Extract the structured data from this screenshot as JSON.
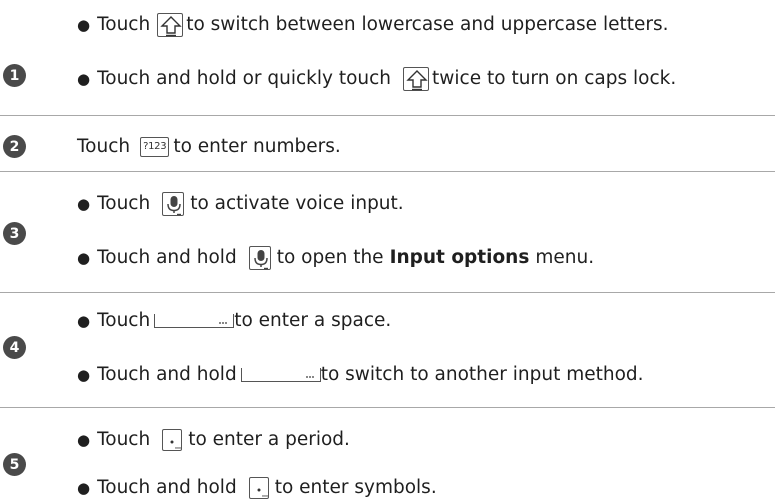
{
  "rows": [
    {
      "number": "1",
      "lines": [
        {
          "prefix": "Touch",
          "icon": "shift-key-icon",
          "suffix": "to switch between lowercase and uppercase letters."
        },
        {
          "prefix": "Touch and hold or quickly touch",
          "icon": "shift-key-icon",
          "suffix": "twice to turn on caps lock."
        }
      ]
    },
    {
      "number": "2",
      "lines": [
        {
          "prefix": "Touch",
          "icon": "numbers-key-icon",
          "key_label": "?123",
          "suffix": "to enter numbers."
        }
      ]
    },
    {
      "number": "3",
      "lines": [
        {
          "prefix": "Touch",
          "icon": "microphone-key-icon",
          "suffix": "to activate voice input."
        },
        {
          "prefix": "Touch and hold",
          "icon": "microphone-key-icon",
          "suffix_pre": "to open the",
          "suffix_bold": "Input options",
          "suffix_post": "menu."
        }
      ]
    },
    {
      "number": "4",
      "lines": [
        {
          "prefix": "Touch",
          "icon": "space-key-icon",
          "suffix": "to enter a space."
        },
        {
          "prefix": "Touch and hold",
          "icon": "space-key-icon",
          "suffix": "to switch to another input method."
        }
      ]
    },
    {
      "number": "5",
      "lines": [
        {
          "prefix": "Touch",
          "icon": "period-key-icon",
          "suffix": "to enter a period."
        },
        {
          "prefix": "Touch and hold",
          "icon": "period-key-icon",
          "suffix": "to enter symbols."
        }
      ]
    }
  ],
  "colors": {
    "badge": "#4a4a4a",
    "divider": "#a8a8a8",
    "text": "#1f1f1f"
  }
}
